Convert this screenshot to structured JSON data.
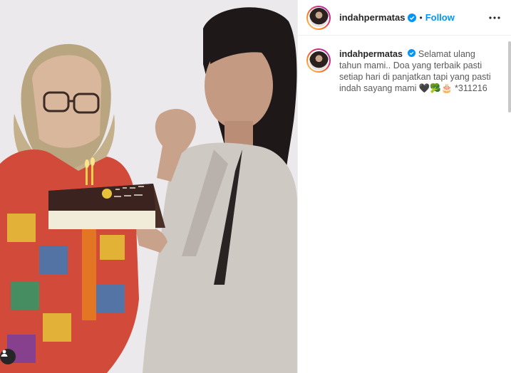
{
  "post": {
    "username": "indahpermatas",
    "follow_label": "Follow",
    "separator": "•",
    "caption_username": "indahpermatas",
    "caption_text": "Selamat ulang tahun mami.. Doa yang terbaik pasti setiap hari di panjatkan tapi yang pasti indah sayang mami 🖤🥦🎂 *311216"
  },
  "icons": {
    "verified": "verified-badge-icon",
    "more": "more-options-icon",
    "user_tag": "user-tag-icon"
  },
  "colors": {
    "accent": "#0095f6",
    "text": "#262626",
    "border": "#efefef"
  }
}
